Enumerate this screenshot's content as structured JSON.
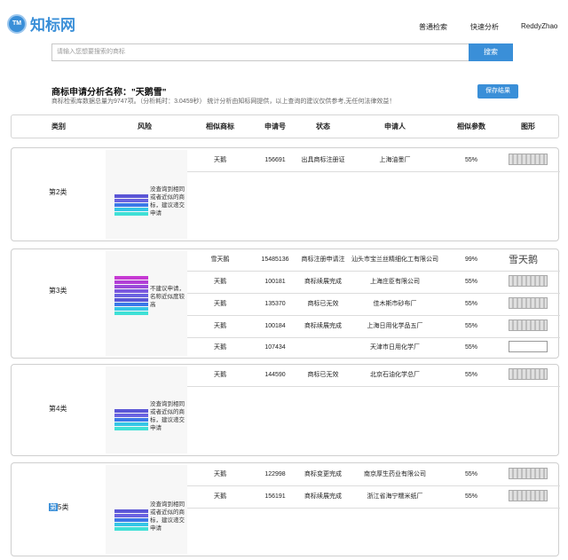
{
  "header": {
    "logo_badge": "TM",
    "logo_text": "知标网",
    "nav": [
      "普通检索",
      "快速分析",
      "ReddyZhao"
    ]
  },
  "search": {
    "placeholder": "请输入您想要搜索的商标",
    "button": "搜索"
  },
  "analysis": {
    "title": "商标申请分析名称：\"天鹅雪\"",
    "subtitle": "商标检索库数据总量为9747项。（分析耗时：3.0459秒）    统计分析由知标网提供，以上查询的建议仅供参考,无任何法律效益！",
    "save_button": "保存结果"
  },
  "columns": [
    "类别",
    "风险",
    "相似商标",
    "申请号",
    "状态",
    "申请人",
    "相似参数",
    "图形"
  ],
  "colors": {
    "accent": "#3a8fd8"
  },
  "groups": [
    {
      "category": "第2类",
      "risk_text": "没查询到相同或者近似的商标，建议递交申请",
      "risk_bars": [
        "#5b56d6",
        "#6a63e0",
        "#3b78e8",
        "#35c6e6",
        "#3fe0d6"
      ],
      "rows": [
        {
          "mark": "天鹅",
          "app_no": "156691",
          "status": "出具商标注册证",
          "applicant": "上海油墨厂",
          "similarity": "55%",
          "image": "mark-img"
        }
      ]
    },
    {
      "category": "第3类",
      "risk_text": "不建议申请，名称近似度较高",
      "risk_bars": [
        "#c63ad3",
        "#b23fd6",
        "#9a4ad9",
        "#7a58de",
        "#6a63e0",
        "#5b56d6",
        "#3b78e8",
        "#35c6e6",
        "#3fe0d6"
      ],
      "rows": [
        {
          "mark": "雪天鹅",
          "app_no": "15485136",
          "status": "商标注册申请注",
          "applicant": "汕头市宝兰丝精细化工有限公司",
          "similarity": "99%",
          "image_text": "雪天鹅"
        },
        {
          "mark": "天鹅",
          "app_no": "100181",
          "status": "商标续展完成",
          "applicant": "上海庄臣有限公司",
          "similarity": "55%",
          "image": "mark-img"
        },
        {
          "mark": "天鹅",
          "app_no": "135370",
          "status": "商标已无效",
          "applicant": "佳木斯市砂布厂",
          "similarity": "55%",
          "image": "mark-img"
        },
        {
          "mark": "天鹅",
          "app_no": "100184",
          "status": "商标续展完成",
          "applicant": "上海日用化学品五厂",
          "similarity": "55%",
          "image": "mark-img"
        },
        {
          "mark": "天鹅",
          "app_no": "107434",
          "status": "",
          "applicant": "天津市日用化学厂",
          "similarity": "55%",
          "image": "plain"
        }
      ]
    },
    {
      "category": "第4类",
      "risk_text": "没查询到相同或者近似的商标，建议递交申请",
      "risk_bars": [
        "#5b56d6",
        "#6a63e0",
        "#3b78e8",
        "#35c6e6",
        "#3fe0d6"
      ],
      "rows": [
        {
          "mark": "天鹅",
          "app_no": "144590",
          "status": "商标已无效",
          "applicant": "北京石油化学总厂",
          "similarity": "55%",
          "image": "mark-img"
        }
      ]
    },
    {
      "category_highlight": "第",
      "category": "5类",
      "risk_text": "没查询到相同或者近似的商标，建议递交申请",
      "risk_bars": [
        "#5b56d6",
        "#6a63e0",
        "#3b78e8",
        "#35c6e6",
        "#3fe0d6"
      ],
      "rows": [
        {
          "mark": "天鹅",
          "app_no": "122998",
          "status": "商标变更完成",
          "applicant": "南京厚生药业有限公司",
          "similarity": "55%",
          "image": "mark-img"
        },
        {
          "mark": "天鹅",
          "app_no": "156191",
          "status": "商标续展完成",
          "applicant": "浙江省海宁糯米纸厂",
          "similarity": "55%",
          "image": "mark-img"
        }
      ]
    }
  ]
}
